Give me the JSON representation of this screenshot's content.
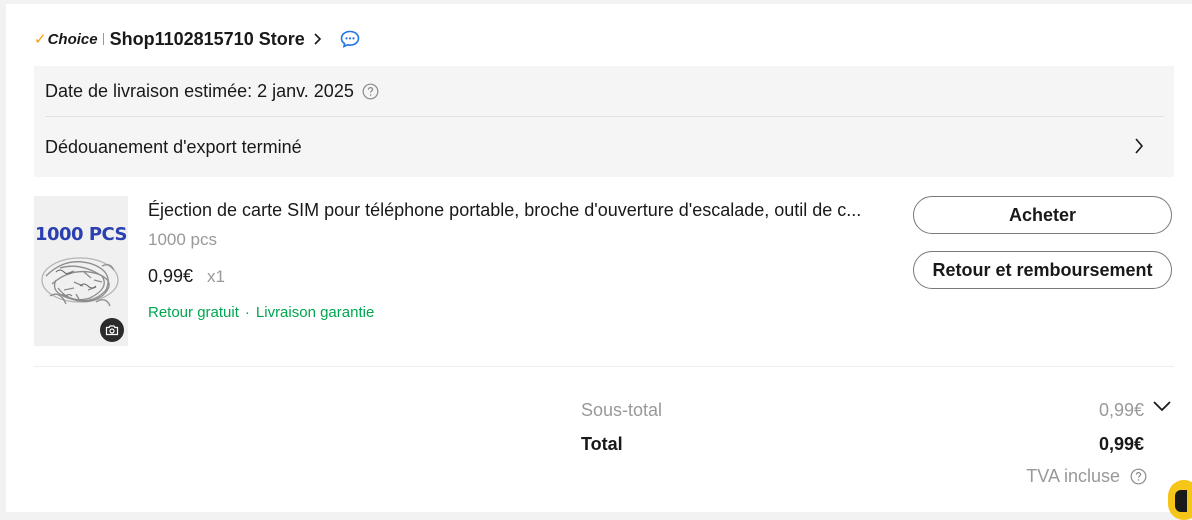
{
  "store": {
    "choice_label": "Choice",
    "name": "Shop1102815710 Store",
    "chevron_icon": "chevron-right-icon",
    "chat_icon": "chat-bubble-icon"
  },
  "delivery": {
    "estimated_date": "Date de livraison estimée: 2 janv. 2025",
    "status": "Dédouanement d'export terminé"
  },
  "product": {
    "image_label": "1000 PCS",
    "title": "Éjection de carte SIM pour téléphone portable, broche d'ouverture d'escalade, outil de c...",
    "variant": "1000 pcs",
    "price": "0,99€",
    "quantity": "x1",
    "benefit_1": "Retour gratuit",
    "benefit_sep": "·",
    "benefit_2": "Livraison garantie"
  },
  "actions": {
    "buy_label": "Acheter",
    "refund_label": "Retour et remboursement"
  },
  "summary": {
    "subtotal_label": "Sous-total",
    "subtotal_value": "0,99€",
    "total_label": "Total",
    "total_value": "0,99€",
    "vat_label": "TVA incluse"
  },
  "colors": {
    "choice_check": "#fd9a00",
    "benefit_green": "#00a650",
    "thumb_label_blue": "#2a3fb0",
    "chat_blue": "#1f74e6"
  }
}
